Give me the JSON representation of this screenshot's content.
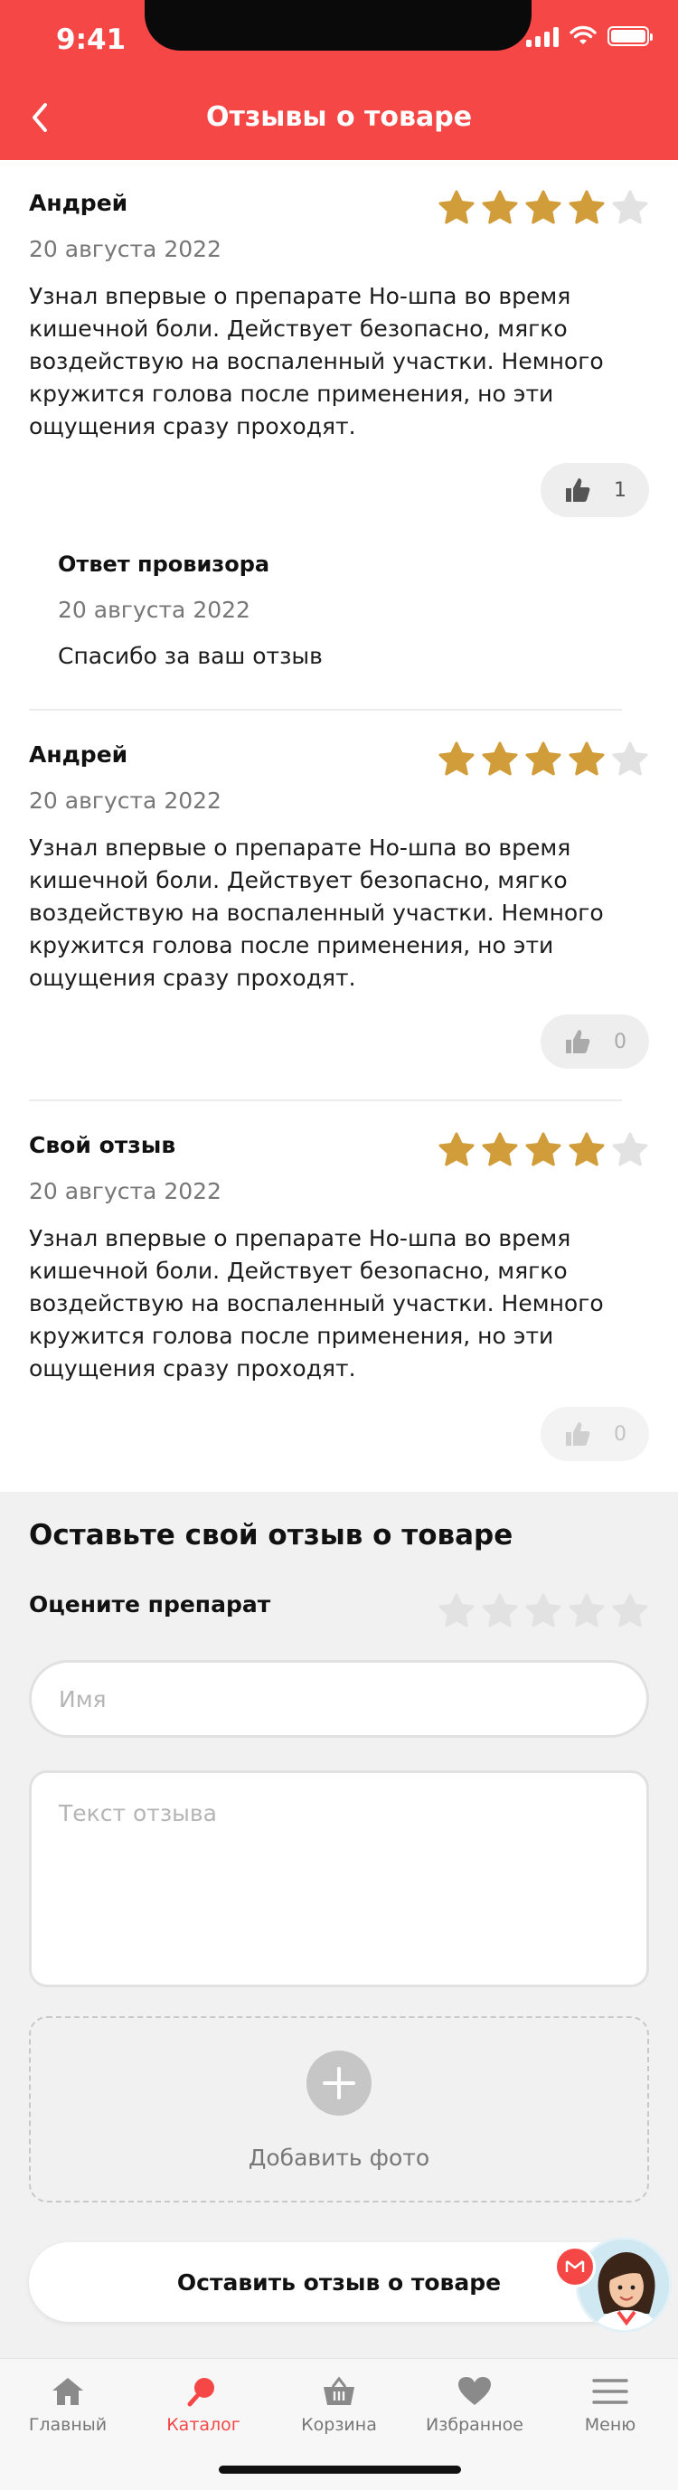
{
  "status_bar": {
    "time": "9:41"
  },
  "header": {
    "title": "Отзывы о товаре"
  },
  "reviews": [
    {
      "author": "Андрей",
      "rating": 4,
      "date": "20 августа 2022",
      "text": "Узнал впервые о препарате Но-шпа во время кишечной боли. Действует безопасно, мягко воздействую на воспаленный участки. Немного кружится голова после применения, но эти ощущения сразу проходят.",
      "likes": "1",
      "reply": {
        "title": "Ответ провизора",
        "date": "20 августа 2022",
        "text": "Спасибо за ваш отзыв"
      }
    },
    {
      "author": "Андрей",
      "rating": 4,
      "date": "20 августа 2022",
      "text": "Узнал впервые о препарате Но-шпа во время кишечной боли. Действует безопасно, мягко воздействую на воспаленный участки. Немного кружится голова после применения, но эти ощущения сразу проходят.",
      "likes": "0"
    },
    {
      "author": "Свой отзыв",
      "rating": 4,
      "date": "20 августа 2022",
      "text": "Узнал впервые о препарате Но-шпа во время кишечной боли. Действует безопасно, мягко воздействую на воспаленный участки. Немного кружится голова после применения, но эти ощущения сразу проходят.",
      "likes": "0"
    }
  ],
  "form": {
    "title": "Оставьте свой отзыв о товаре",
    "rate_label": "Оцените препарат",
    "rating": 0,
    "name_placeholder": "Имя",
    "text_placeholder": "Текст отзыва",
    "add_photo_label": "Добавить фото",
    "submit_label": "Оставить отзыв о товаре"
  },
  "tabbar": {
    "items": [
      {
        "label": "Главный",
        "icon": "home-icon",
        "active": false
      },
      {
        "label": "Каталог",
        "icon": "search-icon",
        "active": true
      },
      {
        "label": "Корзина",
        "icon": "basket-icon",
        "active": false
      },
      {
        "label": "Избранное",
        "icon": "heart-icon",
        "active": false
      },
      {
        "label": "Меню",
        "icon": "menu-icon",
        "active": false
      }
    ]
  },
  "colors": {
    "brand_red": "#f64747",
    "star_filled": "#d19c3a",
    "star_empty": "#e2e2e2",
    "tab_inactive": "#777777"
  }
}
